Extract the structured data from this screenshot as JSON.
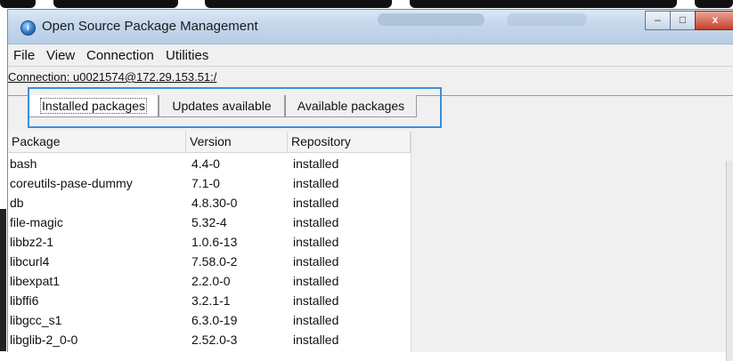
{
  "window": {
    "title": "Open Source Package Management",
    "controls": {
      "minimize": "–",
      "maximize": "□",
      "close": "x"
    }
  },
  "menu": [
    "File",
    "View",
    "Connection",
    "Utilities"
  ],
  "connection": {
    "text": "Connection: u0021574@172.29.153.51:/"
  },
  "tabs": [
    {
      "label": "Installed packages",
      "active": true
    },
    {
      "label": "Updates available",
      "active": false
    },
    {
      "label": "Available packages",
      "active": false
    }
  ],
  "table": {
    "columns": [
      "Package",
      "Version",
      "Repository"
    ],
    "rows": [
      [
        "bash",
        "4.4-0",
        "installed"
      ],
      [
        "coreutils-pase-dummy",
        "7.1-0",
        "installed"
      ],
      [
        "db",
        "4.8.30-0",
        "installed"
      ],
      [
        "file-magic",
        "5.32-4",
        "installed"
      ],
      [
        "libbz2-1",
        "1.0.6-13",
        "installed"
      ],
      [
        "libcurl4",
        "7.58.0-2",
        "installed"
      ],
      [
        "libexpat1",
        "2.2.0-0",
        "installed"
      ],
      [
        "libffi6",
        "3.2.1-1",
        "installed"
      ],
      [
        "libgcc_s1",
        "6.3.0-19",
        "installed"
      ],
      [
        "libglib-2_0-0",
        "2.52.0-3",
        "installed"
      ]
    ]
  },
  "colors": {
    "highlight": "#3a8ee0",
    "titlebar": "#c5d7ec",
    "close_button": "#c7412a"
  }
}
